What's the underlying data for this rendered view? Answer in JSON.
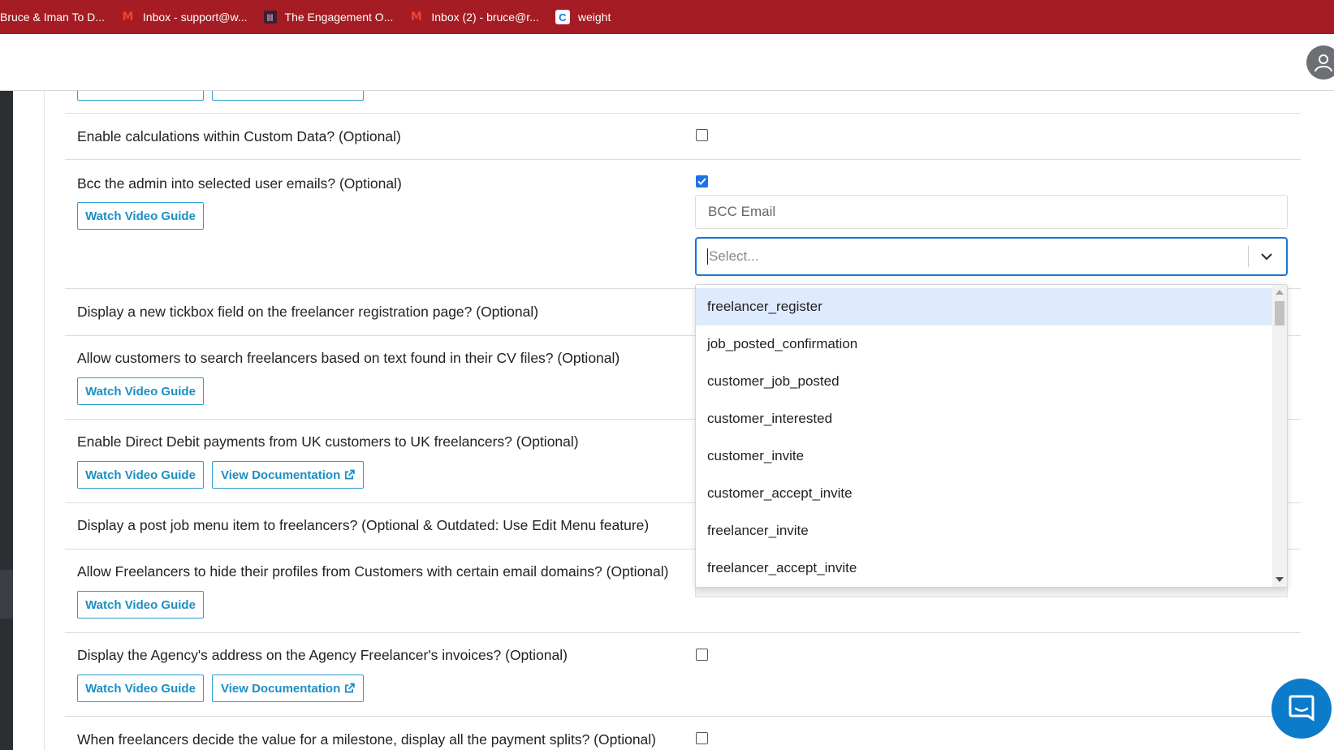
{
  "bookmarks": [
    {
      "label": "Bruce & Iman To D...",
      "icon": "none"
    },
    {
      "label": "Inbox - support@w...",
      "icon": "gmail-icon"
    },
    {
      "label": "The Engagement O...",
      "icon": "engagement-icon"
    },
    {
      "label": "Inbox (2) - bruce@r...",
      "icon": "gmail-icon"
    },
    {
      "label": "weight",
      "icon": "calendar-icon"
    }
  ],
  "buttons": {
    "watch_video": "Watch Video Guide",
    "view_docs": "View Documentation"
  },
  "settings": {
    "calc": "Enable calculations within Custom Data? (Optional)",
    "bcc": "Bcc the admin into selected user emails? (Optional)",
    "tickbox": "Display a new tickbox field on the freelancer registration page? (Optional)",
    "cv_search": "Allow customers to search freelancers based on text found in their CV files? (Optional)",
    "direct_debit": "Enable Direct Debit payments from UK customers to UK freelancers? (Optional)",
    "post_job": "Display a post job menu item to freelancers? (Optional & Outdated: Use Edit Menu feature)",
    "hide_profiles": "Allow Freelancers to hide their profiles from Customers with certain email domains? (Optional)",
    "agency_address": "Display the Agency's address on the Agency Freelancer's invoices? (Optional)",
    "milestone": "When freelancers decide the value for a milestone, display all the payment splits? (Optional)"
  },
  "bcc_email": {
    "placeholder": "BCC Email",
    "select_placeholder": "Select..."
  },
  "dropdown_options": [
    "freelancer_register",
    "job_posted_confirmation",
    "customer_job_posted",
    "customer_interested",
    "customer_invite",
    "customer_accept_invite",
    "freelancer_invite",
    "freelancer_accept_invite"
  ],
  "colors": {
    "bookmark_bar": "#a51c24",
    "accent_button": "#1b8fc4",
    "select_focus": "#1976d2",
    "option_highlight": "#deebff",
    "chat_bubble": "#0c7bc9"
  }
}
